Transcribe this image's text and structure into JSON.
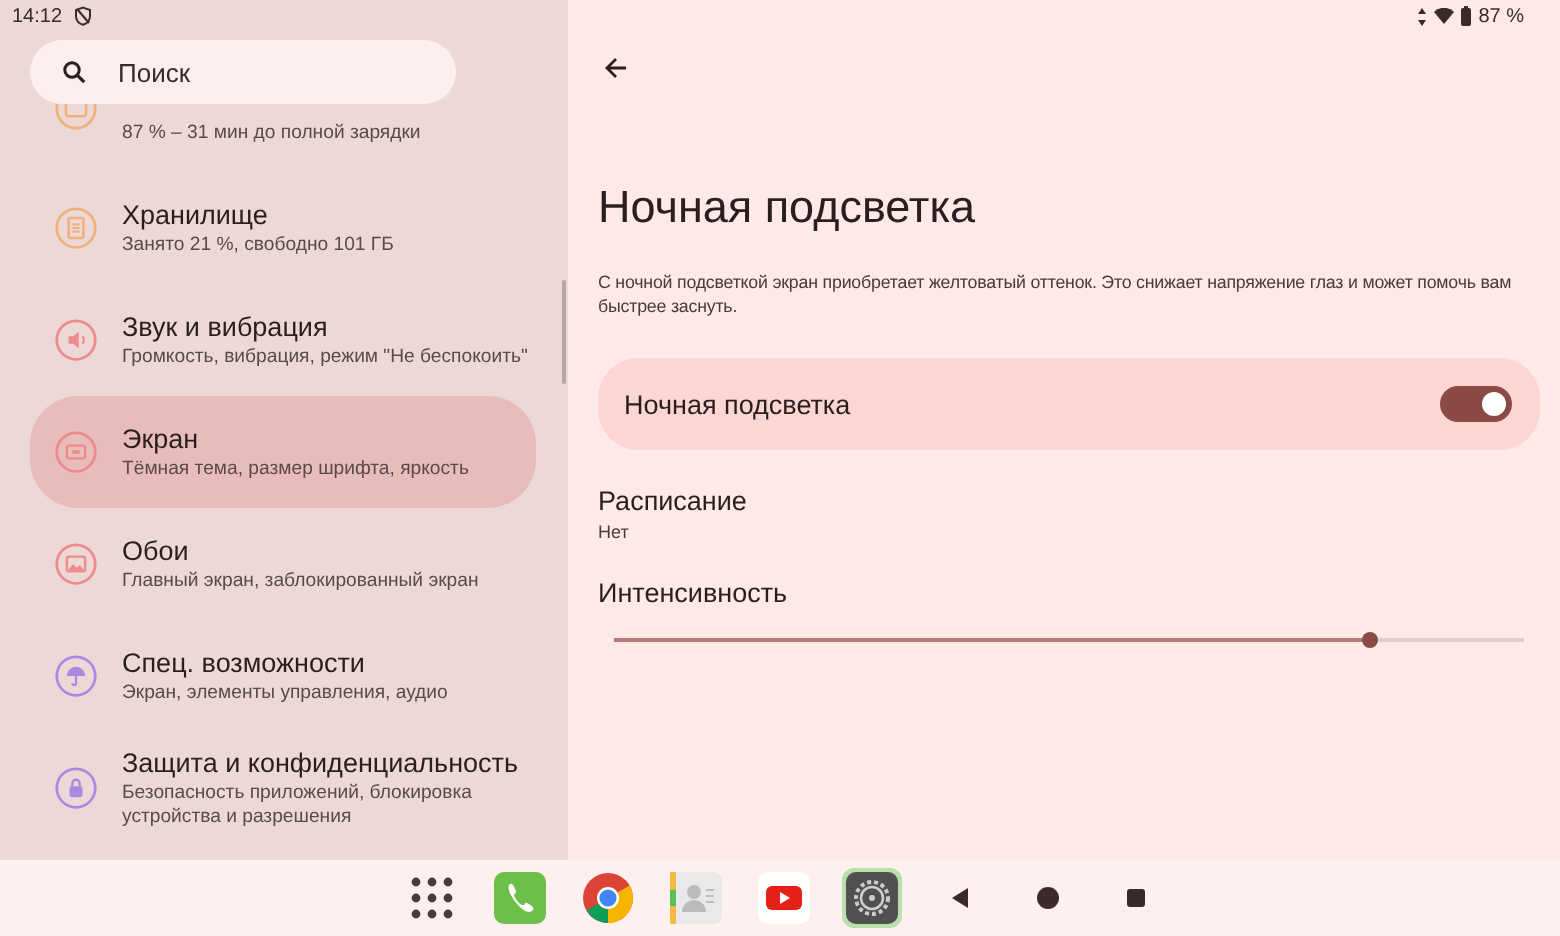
{
  "status_bar": {
    "time": "14:12",
    "battery": "87 %"
  },
  "search": {
    "placeholder": "Поиск"
  },
  "sidebar": {
    "items": [
      {
        "kind": "battery",
        "subtitle": "87 % – 31 мин до полной зарядки",
        "color": "#f0b27a",
        "selected": false
      },
      {
        "kind": "storage",
        "title": "Хранилище",
        "subtitle": "Занято 21 %, свободно 101 ГБ",
        "color": "#f0b27a",
        "selected": false
      },
      {
        "kind": "sound",
        "title": "Звук и вибрация",
        "subtitle": "Громкость, вибрация, режим \"Не беспокоить\"",
        "color": "#ee8a8a",
        "selected": false
      },
      {
        "kind": "display",
        "title": "Экран",
        "subtitle": "Тёмная тема, размер шрифта, яркость",
        "color": "#ee8a8a",
        "selected": true
      },
      {
        "kind": "wallpaper",
        "title": "Обои",
        "subtitle": "Главный экран, заблокированный экран",
        "color": "#ee8a8a",
        "selected": false
      },
      {
        "kind": "accessibility",
        "title": "Спец. возможности",
        "subtitle": "Экран, элементы управления, аудио",
        "color": "#a98ae0",
        "selected": false
      },
      {
        "kind": "lock",
        "title": "Защита и конфиденциальность",
        "subtitle": "Безопасность приложений, блокировка устройства и разрешения",
        "color": "#a98ae0",
        "selected": false
      }
    ]
  },
  "page": {
    "title": "Ночная подсветка",
    "description": "С ночной подсветкой экран приобретает желтоватый оттенок. Это снижает напряжение глаз и может помочь вам быстрее заснуть.",
    "toggle": {
      "label": "Ночная подсветка",
      "on": true
    },
    "schedule": {
      "label": "Расписание",
      "value": "Нет"
    },
    "intensity": {
      "label": "Интенсивность",
      "level": 0.83
    }
  },
  "dock": [
    {
      "kind": "apps",
      "selected": false
    },
    {
      "kind": "phone",
      "selected": false
    },
    {
      "kind": "browser",
      "selected": false
    },
    {
      "kind": "contacts",
      "selected": false
    },
    {
      "kind": "video",
      "selected": false
    },
    {
      "kind": "settings",
      "selected": true
    },
    {
      "kind": "back",
      "selected": false
    },
    {
      "kind": "home",
      "selected": false
    },
    {
      "kind": "recents",
      "selected": false
    }
  ]
}
